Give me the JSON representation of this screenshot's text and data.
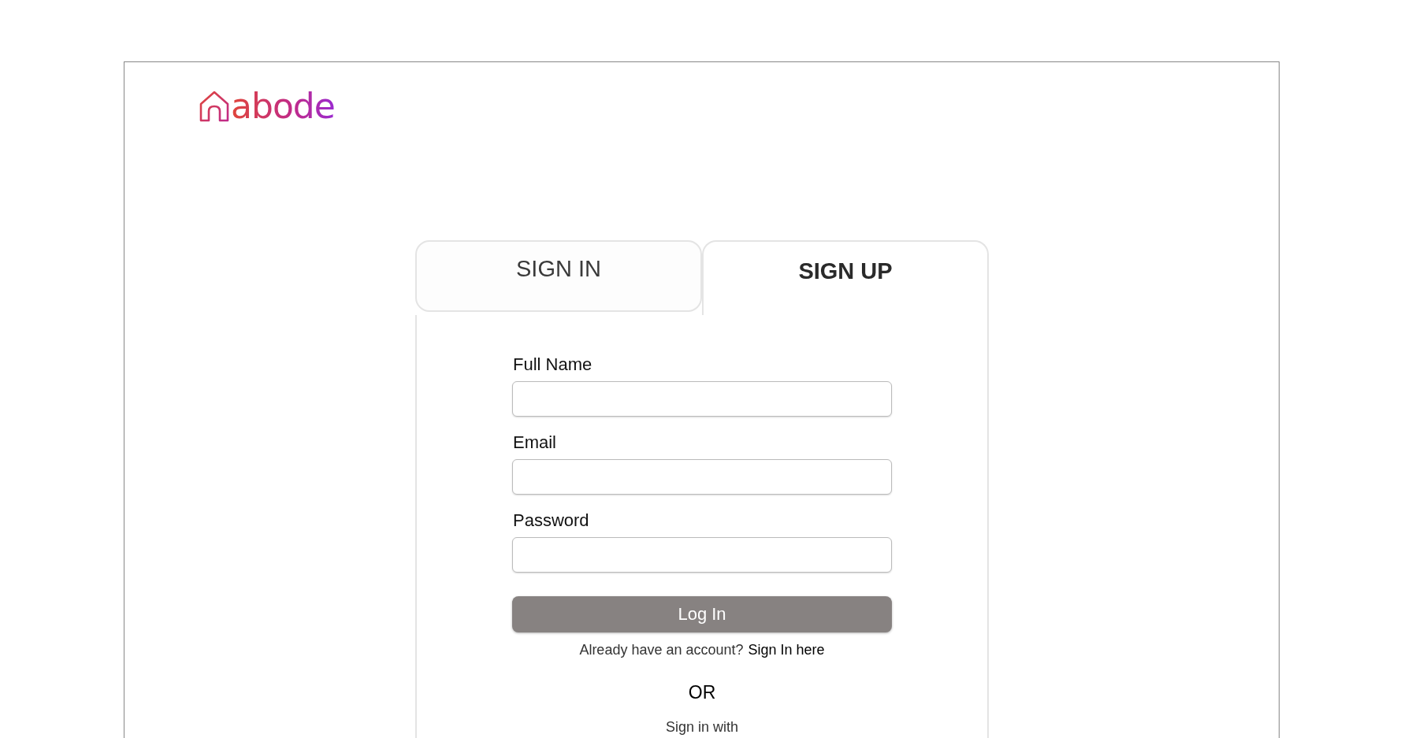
{
  "logo": {
    "text": "abode"
  },
  "tabs": [
    {
      "label": "SIGN IN",
      "selected": false
    },
    {
      "label": "SIGN UP",
      "selected": true
    }
  ],
  "form": {
    "fields": [
      {
        "label": "Full Name"
      },
      {
        "label": "Email"
      },
      {
        "label": "Password"
      }
    ],
    "submit": "Log In",
    "account_prompt": "Already have an account?",
    "account_link": "Sign In here",
    "divider": "OR",
    "social_prompt": "Sign in with"
  }
}
